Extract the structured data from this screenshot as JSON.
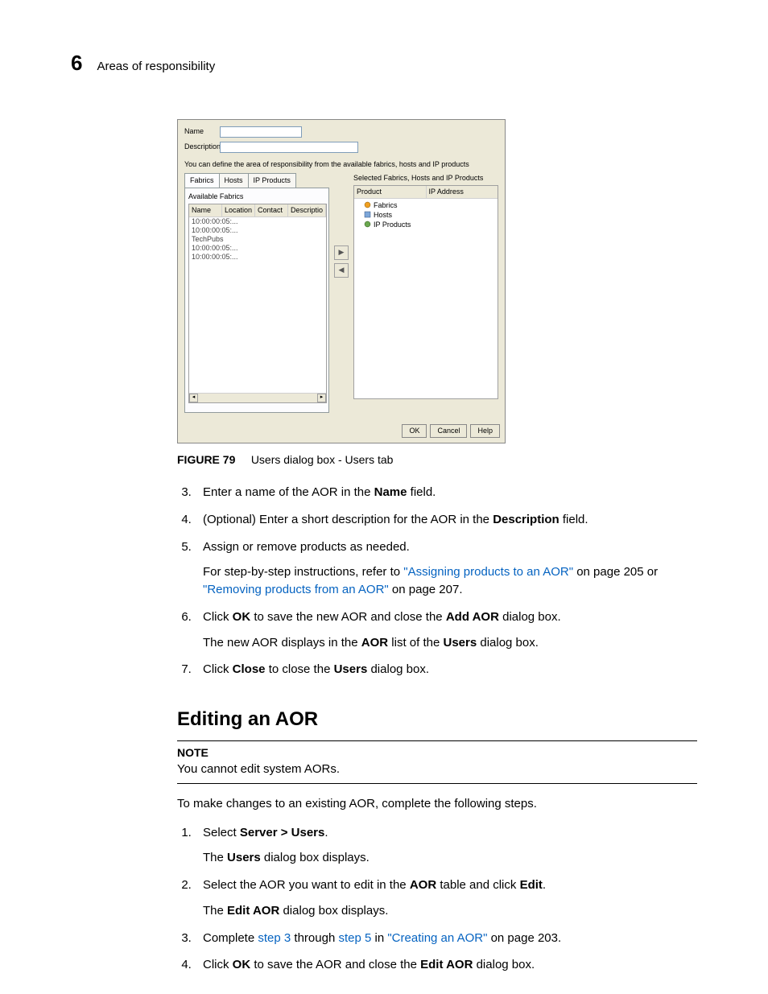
{
  "header": {
    "chapter_number": "6",
    "chapter_title": "Areas of responsibility"
  },
  "dialog": {
    "labels": {
      "name": "Name",
      "description": "Description"
    },
    "hint": "You can define the area of responsibility from the available fabrics, hosts and IP products",
    "tabs": [
      "Fabrics",
      "Hosts",
      "IP Products"
    ],
    "left": {
      "title": "Available Fabrics",
      "columns": [
        "Name",
        "Location",
        "Contact",
        "Descriptio"
      ],
      "rows": [
        "10:00:00:05:...",
        "10:00:00:05:...",
        "TechPubs",
        "10:00:00:05:...",
        "10:00:00:05:..."
      ]
    },
    "right": {
      "title": "Selected Fabrics, Hosts and IP Products",
      "columns": [
        "Product",
        "IP Address"
      ],
      "tree": [
        "Fabrics",
        "Hosts",
        "IP Products"
      ]
    },
    "buttons": {
      "ok": "OK",
      "cancel": "Cancel",
      "help": "Help"
    }
  },
  "figure": {
    "label": "FIGURE 79",
    "caption": "Users dialog box - Users tab"
  },
  "first_steps": {
    "s3": {
      "pre": "Enter a name of the AOR in the ",
      "b": "Name",
      "post": " field."
    },
    "s4": {
      "pre": "(Optional) Enter a short description for the AOR in the ",
      "b": "Description",
      "post": " field."
    },
    "s5": {
      "t": "Assign or remove products as needed.",
      "sub_pre": "For step-by-step instructions, refer to ",
      "l1": "\"Assigning products to an AOR\"",
      "mid1": " on page 205 or ",
      "l2": "\"Removing products from an AOR\"",
      "post": " on page 207."
    },
    "s6": {
      "a": "Click ",
      "b": "OK",
      "c": " to save the new AOR and close the ",
      "d": "Add AOR",
      "e": " dialog box.",
      "f": "The new AOR displays in the ",
      "g": "AOR",
      "h": " list of the ",
      "i": "Users",
      "j": " dialog box."
    },
    "s7": {
      "a": "Click ",
      "b": "Close",
      "c": " to close the ",
      "d": "Users",
      "e": " dialog box."
    }
  },
  "section2": {
    "heading": "Editing an AOR",
    "note_label": "NOTE",
    "note_text": "You cannot edit system AORs.",
    "intro": "To make changes to an existing AOR, complete the following steps.",
    "s1": {
      "a": "Select ",
      "b": "Server > Users",
      "c": ".",
      "d": "The ",
      "e": "Users",
      "f": " dialog box displays."
    },
    "s2": {
      "a": "Select the AOR you want to edit in the ",
      "b": "AOR",
      "c": " table and click ",
      "d": "Edit",
      "e": ".",
      "f": "The ",
      "g": "Edit AOR",
      "h": " dialog box displays."
    },
    "s3": {
      "a": "Complete ",
      "l1": "step 3",
      "b": " through ",
      "l2": "step 5",
      "c": " in ",
      "l3": "\"Creating an AOR\"",
      "d": " on page 203."
    },
    "s4": {
      "a": "Click ",
      "b": "OK",
      "c": " to save the AOR and close the ",
      "d": "Edit AOR",
      "e": " dialog box."
    }
  }
}
